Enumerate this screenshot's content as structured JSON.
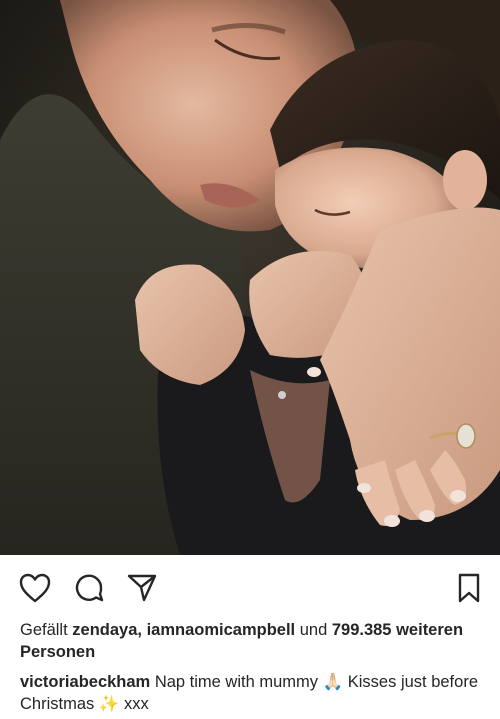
{
  "post": {
    "photo": {
      "subject": "photo"
    },
    "actions": {
      "like_icon": "heart-icon",
      "comment_icon": "comment-icon",
      "share_icon": "paper-plane-icon",
      "save_icon": "bookmark-icon"
    },
    "likes": {
      "prefix": "Gefällt",
      "users": "zendaya, iamnaomicampbell",
      "connector": "und",
      "count": "799.385",
      "suffix": "weiteren Personen"
    },
    "caption": {
      "username": "victoriabeckham",
      "text_part1": "Nap time with mummy",
      "emoji_pray": "🙏🏻",
      "text_part2": "Kisses just before Christmas",
      "emoji_sparkles": "✨",
      "text_part3": "xxx"
    }
  },
  "colors": {
    "text": "#262626",
    "icon": "#262626",
    "background": "#ffffff"
  }
}
